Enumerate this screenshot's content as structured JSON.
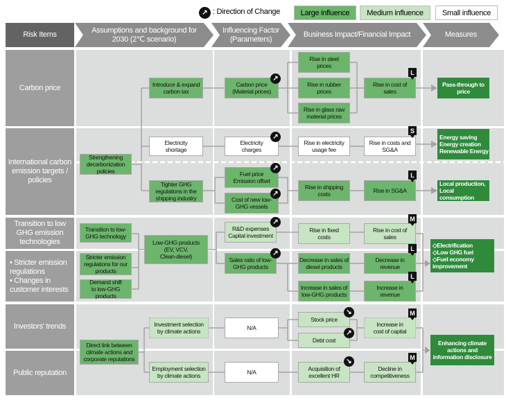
{
  "legend": {
    "direction_label": ": Direction of Change",
    "large": "Large influence",
    "medium": "Medium influence",
    "small": "Small influence",
    "colors": {
      "large": "#6cb56c",
      "medium": "#c7e5c2",
      "small": "#ffffff",
      "measure": "#2f8a3c"
    }
  },
  "header": {
    "risk_items": "Risk Items",
    "assumptions": "Assumptions and background for\n2030 (2℃ scenario)",
    "factor": "Influencing Factor\n(Parameters)",
    "impact": "Business Impact/Financial Impact",
    "measures": "Measures"
  },
  "risks": [
    "Carbon price",
    "International carbon\nemission targets /\npolicies",
    "Transition to low\nGHG emission\ntechnologies",
    "• Stricter emission\n  regulations\n• Changes in\n  customer interests",
    "Investors' trends",
    "Public reputation"
  ],
  "boxes": {
    "carbon_tax": "Introduce & expand\ncarbon tax",
    "carbon_price": "Carbon price\n(Material prices)",
    "steel": "Rise in steel\nprices",
    "rubber": "Rise in rubber\nprices",
    "glass": "Rise in glass raw\nmaterial prices",
    "cost_sales1": "Rise in cost of\nsales",
    "pass_through": "Pass-through to\nprice",
    "elec_shortage": "Electricity\nshortage",
    "elec_charges": "Electricity\ncharges",
    "elec_fee": "Rise in electricity\nusage fee",
    "costs_sga": "Rise in costs and\nSG&A",
    "energy": "Energy saving\nEnergy creation\nRenewable Energy",
    "strengthening": "Strengthening\ndecarbonization\npolicies",
    "tighter_ghg": "Tighter GHG\nregulations in the\nshipping industry",
    "fuel_price": "Fuel price\nEmission offset",
    "vessels": "Cost of new low-\nGHG vessels",
    "shipping": "Rise in shipping\ncosts",
    "sga": "Rise in SG&A",
    "local": "Local production,\nLocal consumption",
    "transition_tech": "Transition to low-\nGHG technology",
    "low_ghg_products": "Low-GHG products\n(EV, VCV,\nClean-diesel)",
    "rnd": "R&D expenses\nCapital investment",
    "fixed_costs": "Rise in fixed\ncosts",
    "cost_sales2": "Rise in cost of\nsales",
    "electrification": "◇Electrification\n◇Low GHG fuel\n◇Fuel economy\n   improvement",
    "stricter": "Stricter emission\nregulations for our\nproducts",
    "sales_ratio": "Sales ratio of low-\nGHG products",
    "diesel": "Decrease in sales of\ndiesel products",
    "dec_revenue": "Decrease in\nrevenue",
    "demand_shift": "Demand shift\nto low-GHG products",
    "inc_low_ghg": "Increase in sales of\nlow-GHG products",
    "inc_revenue": "Increase in\nrevenue",
    "investment_sel": "Investment selection\nby climate actions",
    "na1": "N/A",
    "stock": "Stock price",
    "debt": "Debt cost",
    "cost_capital": "Increase in\ncost of capital",
    "direct_link": "Direct link between\nclimate actions and\ncorporate reputations",
    "enhancing": "Enhancing climate\nactions and\ninformation disclosure",
    "employment_sel": "Employment selection\nby climate actions",
    "na2": "N/A",
    "hr": "Acquisition of\nexcellent HR",
    "competitiveness": "Decline in\ncompetitiveness"
  },
  "badges": {
    "b1": "L",
    "b2": "S",
    "b3": "L",
    "b4": "M",
    "b5": "L",
    "b6": "L",
    "b7": "M",
    "b8": "M"
  },
  "arrows": {
    "up": "↗",
    "down": "↘"
  }
}
